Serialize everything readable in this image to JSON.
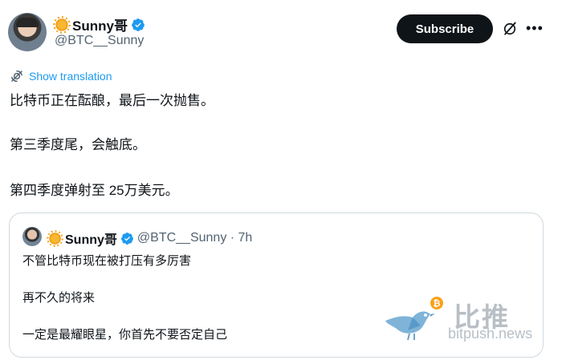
{
  "author": {
    "display_name": "Sunny哥",
    "handle": "@BTC__Sunny",
    "emoji_icon": "sun-icon",
    "verified_color": "#1d9bf0"
  },
  "actions": {
    "subscribe_label": "Subscribe"
  },
  "translate": {
    "label": "Show translation"
  },
  "tweet": {
    "lines": [
      "比特币正在酝酿，最后一次抛售。",
      "第三季度尾，会触底。",
      "第四季度弹射至 25万美元。"
    ]
  },
  "quote": {
    "display_name": "Sunny哥",
    "handle_time": "@BTC__Sunny · 7h",
    "lines": [
      "不管比特币现在被打压有多厉害",
      "再不久的将来",
      "一定是最耀眼星，你首先不要否定自己"
    ]
  },
  "watermark": {
    "cn": "比推",
    "en": "bitpush.news"
  },
  "colors": {
    "accent": "#1d9bf0",
    "text": "#0f1419",
    "muted": "#536471",
    "border": "#cfd9de"
  }
}
